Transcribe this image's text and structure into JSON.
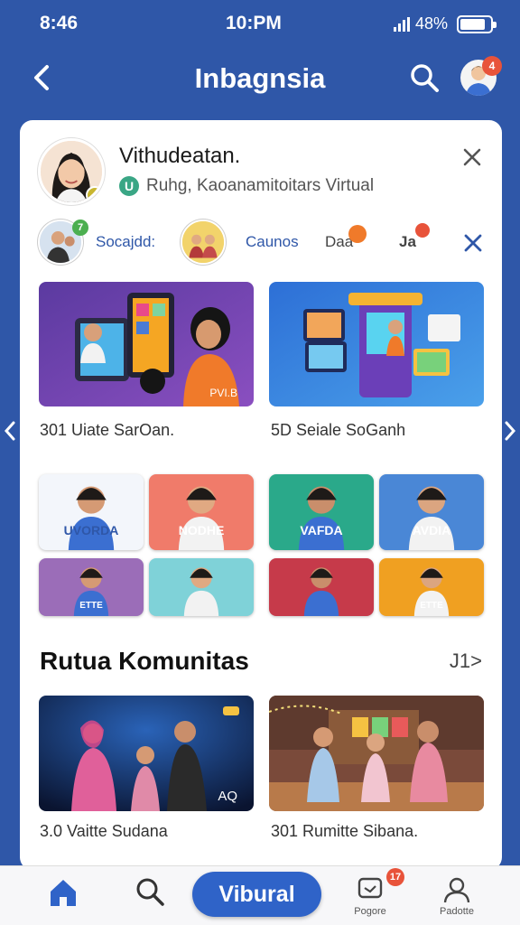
{
  "status_bar": {
    "time_left": "8:46",
    "time_center": "10:PM",
    "battery_text": "48%",
    "battery_level": 0.85
  },
  "header": {
    "title": "Inbagnsia",
    "back_icon": "chevron-left-icon",
    "search_icon": "search-icon",
    "notification_count": "4"
  },
  "profile": {
    "name": "Vithudeatan.",
    "subtitle": "Ruhg, Kaoanamitoitars Virtual",
    "badge_letter": "U"
  },
  "stories": [
    {
      "label": "Socajdd:",
      "badge": "7"
    },
    {
      "label": "Caunos"
    },
    {
      "label": "Daa"
    },
    {
      "label": "Ja"
    }
  ],
  "featured": [
    {
      "caption": "301 Uiate SarOan.",
      "overlay": "PVI.B"
    },
    {
      "caption": "5D Seiale SoGanh"
    }
  ],
  "grid_tiles": [
    {
      "label": "UVORDA",
      "color": "#f3f6fb"
    },
    {
      "label": "NODHE",
      "color": "#f07b6a"
    },
    {
      "label": "VAFDA",
      "color": "#2aa98a"
    },
    {
      "label": "AVDIA",
      "color": "#4a87d6"
    },
    {
      "label": "ETTE",
      "color": "#9b6db8"
    },
    {
      "label": "",
      "color": "#7fd2d8"
    },
    {
      "label": "",
      "color": "#c63a4a"
    },
    {
      "label": "ETTE",
      "color": "#f0a021"
    }
  ],
  "community": {
    "title": "Rutua Komunitas",
    "more_label": "J1>",
    "items": [
      {
        "caption": "3.0 Vaitte Sudana",
        "overlay": "AQ"
      },
      {
        "caption": "301 Rumitte Sibana."
      }
    ]
  },
  "bottom_nav": {
    "primary_label": "Vibural",
    "items": [
      {
        "label": ""
      },
      {
        "label": ""
      },
      {
        "label": "Pogore",
        "badge": "17"
      },
      {
        "label": "Padotte"
      }
    ]
  },
  "colors": {
    "background": "#2f57a8",
    "accent": "#2f63c8",
    "badge": "#e8533a"
  }
}
